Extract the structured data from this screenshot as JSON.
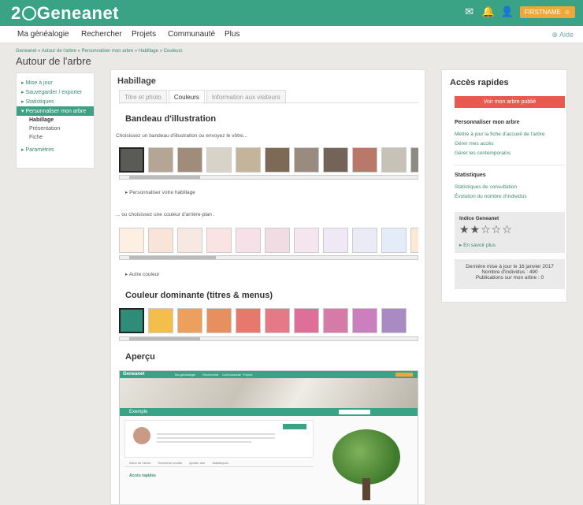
{
  "app": {
    "logo_text": "2 Geneanet",
    "user_label": "FIRSTNAME"
  },
  "nav": {
    "items": [
      "Ma généalogie",
      "Rechercher",
      "Projets",
      "Communauté",
      "Plus"
    ],
    "help": "Aide"
  },
  "breadcrumb": "Geneanet » Autour de l'arbre » Personnaliser mon arbre » Habillage » Couleurs",
  "page_title": "Autour de l'arbre",
  "sidebar": {
    "items": [
      "Mise à jour",
      "Sauvegarder / exporter",
      "Statistiques",
      "Personnaliser mon arbre"
    ],
    "sub": [
      "Habillage",
      "Présentation",
      "Fiche"
    ],
    "last": "Paramètres"
  },
  "main": {
    "title": "Habillage",
    "tabs": [
      "Titre et photo",
      "Couleurs",
      "Information aux visiteurs"
    ],
    "bandeau_title": "Bandeau d'illustration",
    "bandeau_text": "Choisissez un bandeau d'illustration ou envoyez le vôtre...",
    "custom_link": "Personnaliser votre habillage",
    "bg_text": "... ou choisissez une couleur d'arrière-plan :",
    "other_color": "Autre couleur",
    "dominant_title": "Couleur dominante (titres & menus)",
    "apercu_title": "Aperçu",
    "image_thumbs": [
      "#5a5a56",
      "#b4a594",
      "#a08c7a",
      "#d8d3c8",
      "#c4b49a",
      "#7c6a56",
      "#9a8b80",
      "#736358",
      "#b8796a",
      "#c7c2b8",
      "#8d8a84"
    ],
    "bg_colors": [
      "#fdf0e2",
      "#f8e4d8",
      "#f7e8e4",
      "#f9e3e3",
      "#f7e1e8",
      "#efdde3",
      "#f5e5ee",
      "#eee9f4",
      "#ebeaf7",
      "#e3ecf8",
      "#fde9d6"
    ],
    "dominant_colors": [
      "#2f8c78",
      "#f3bf4a",
      "#eda05e",
      "#e7905e",
      "#e6796b",
      "#e57a86",
      "#de6f98",
      "#d67ba8",
      "#cc7fbd",
      "#a98bc4"
    ]
  },
  "preview": {
    "logo": "Geneanet",
    "nav": [
      "Ma généalogie",
      "Rechercher",
      "Communauté",
      "Projets"
    ],
    "bar_title": "Exemple",
    "tabs": [
      "Arbre de l'arbre",
      "Dernières modifs",
      "Ajouter des",
      "Statistiques"
    ],
    "acces": "Accès rapides"
  },
  "right": {
    "title": "Accès rapides",
    "button": "Voir mon arbre publié",
    "section1": "Personnaliser mon arbre",
    "links1": [
      "Mettre à jour la fiche d'accueil de l'arbre",
      "Gérer mes accès",
      "Gérer les contemporains"
    ],
    "section2": "Statistiques",
    "links2": [
      "Statistiques de consultation",
      "Évolution du nombre d'individus"
    ],
    "indice_title": "Indice Geneanet",
    "stars": "★★☆☆☆",
    "indice_link": "En savoir plus",
    "update_line1": "Dernière mise à jour le 16 janvier 2017",
    "update_line2": "Nombre d'individus : 490",
    "update_line3": "Publications sur mon arbre : 0"
  }
}
